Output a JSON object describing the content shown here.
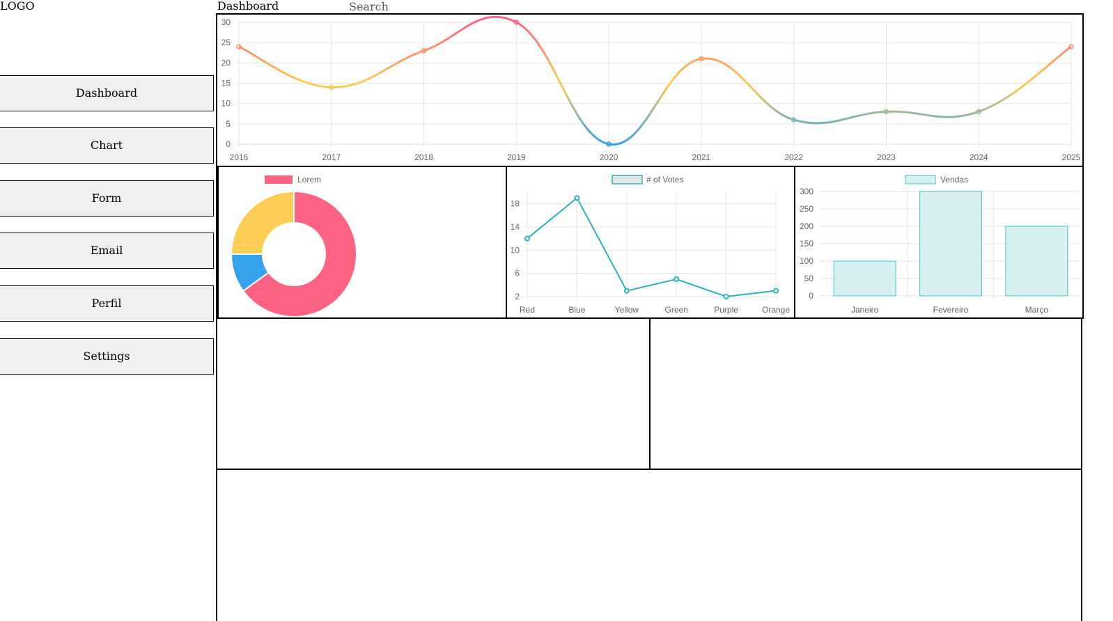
{
  "header": {
    "logo": "LOGO",
    "title": "Dashboard",
    "search_placeholder": "Search"
  },
  "sidebar": {
    "items": [
      {
        "label": "Dashboard"
      },
      {
        "label": "Chart"
      },
      {
        "label": "Form"
      },
      {
        "label": "Email"
      },
      {
        "label": "Perfil"
      },
      {
        "label": "Settings"
      }
    ]
  },
  "chart_data": [
    {
      "type": "line",
      "x": [
        "2016",
        "2017",
        "2018",
        "2019",
        "2020",
        "2021",
        "2022",
        "2023",
        "2024",
        "2025"
      ],
      "values": [
        24,
        14,
        23,
        30,
        0,
        21,
        6,
        8,
        8,
        24
      ],
      "ylim": [
        0,
        30
      ],
      "yticks": [
        "0",
        "5",
        "10",
        "15",
        "20",
        "25",
        "30"
      ],
      "grid": true,
      "colors": {
        "high": "#ff6384",
        "mid": "#ffcd56",
        "low": "#36a2eb"
      }
    },
    {
      "type": "pie",
      "legend": [
        "Lorem"
      ],
      "legend_position": "top",
      "values": [
        65,
        10,
        25
      ],
      "colors": [
        "#ff6384",
        "#36a2eb",
        "#ffcd56"
      ]
    },
    {
      "type": "line",
      "series": [
        {
          "name": "# of Votes",
          "values": [
            12,
            19,
            3,
            5,
            2,
            3
          ]
        }
      ],
      "categories": [
        "Red",
        "Blue",
        "Yellow",
        "Green",
        "Purple",
        "Orange"
      ],
      "yticks": [
        "2",
        "6",
        "10",
        "14",
        "18"
      ],
      "ylim": [
        2,
        20
      ],
      "color": "#2bb3b8"
    },
    {
      "type": "bar",
      "series": [
        {
          "name": "Vendas",
          "values": [
            100,
            300,
            200
          ]
        }
      ],
      "categories": [
        "Janeiro",
        "Fevereiro",
        "Março"
      ],
      "yticks": [
        "0",
        "50",
        "100",
        "150",
        "200",
        "250",
        "300"
      ],
      "ylim": [
        0,
        300
      ],
      "color": "#d7f0f1",
      "border": "#4bc0c0"
    }
  ]
}
